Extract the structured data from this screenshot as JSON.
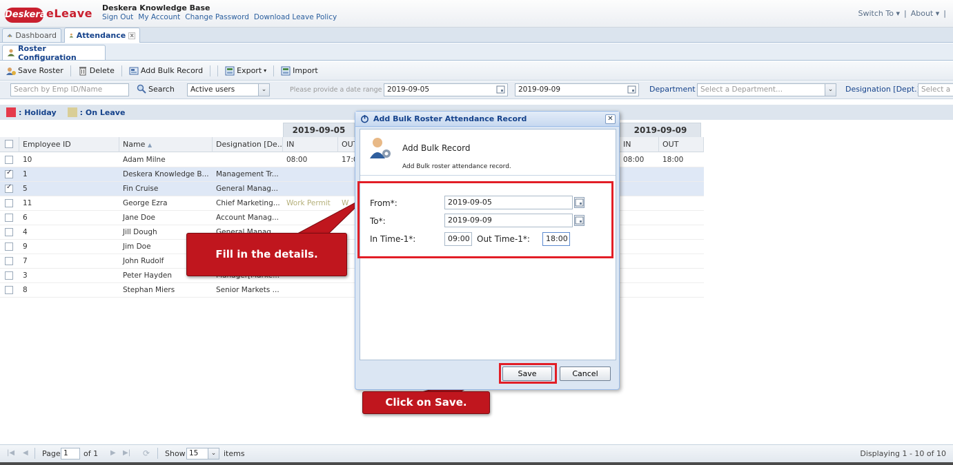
{
  "header": {
    "logo_brand": "Deskera",
    "logo_product": "eLeave",
    "company": "Deskera Knowledge Base",
    "links": [
      "Sign Out",
      "My Account",
      "Change Password",
      "Download Leave Policy"
    ],
    "switch_to": "Switch To",
    "about": "About"
  },
  "tabs": {
    "dashboard": "Dashboard",
    "attendance": "Attendance",
    "roster_config": "Roster Configuration"
  },
  "toolbar": {
    "save_roster": "Save Roster",
    "delete": "Delete",
    "add_bulk": "Add Bulk Record",
    "export": "Export",
    "import": "Import"
  },
  "filters": {
    "search_placeholder": "Search by Emp ID/Name",
    "search_button": "Search",
    "user_filter": "Active users",
    "date_hint": "Please provide a date range",
    "date_from": "2019-09-05",
    "date_to": "2019-09-09",
    "department_label": "Department :",
    "department_placeholder": "Select a Department...",
    "designation_label": "Designation [Dept.] :",
    "designation_placeholder": "Select a"
  },
  "legend": {
    "holiday": ": Holiday",
    "on_leave": ": On Leave",
    "holiday_color": "#e53a4a",
    "leave_color": "#d9ce97"
  },
  "grid": {
    "date_group_1": "2019-09-05",
    "date_group_2": "2019-09-09",
    "headers": {
      "employee_id": "Employee ID",
      "name": "Name",
      "designation": "Designation [De...",
      "in": "IN",
      "out": "OUT"
    },
    "rows": [
      {
        "id": "10",
        "name": "Adam Milne",
        "designation": "",
        "in1": "08:00",
        "out1": "17:0",
        "in2": "08:00",
        "out2": "18:00",
        "selected": false
      },
      {
        "id": "1",
        "name": "Deskera Knowledge B...",
        "designation": "Management Tr...",
        "in1": "",
        "out1": "",
        "in2": "",
        "out2": "",
        "selected": true
      },
      {
        "id": "5",
        "name": "Fin Cruise",
        "designation": "General Manag...",
        "in1": "",
        "out1": "",
        "in2": "",
        "out2": "",
        "selected": true
      },
      {
        "id": "11",
        "name": "George Ezra",
        "designation": "Chief Marketing...",
        "in1": "Work Permit",
        "out1": "W",
        "in2": "",
        "out2": "",
        "selected": false
      },
      {
        "id": "6",
        "name": "Jane Doe",
        "designation": "Account Manag...",
        "in1": "",
        "out1": "",
        "in2": "",
        "out2": "",
        "selected": false
      },
      {
        "id": "4",
        "name": "Jill Dough",
        "designation": "General Manag...",
        "in1": "",
        "out1": "",
        "in2": "",
        "out2": "",
        "selected": false
      },
      {
        "id": "9",
        "name": "Jim Doe",
        "designation": "",
        "in1": "",
        "out1": "",
        "in2": "",
        "out2": "",
        "selected": false
      },
      {
        "id": "7",
        "name": "John Rudolf",
        "designation": "",
        "in1": "",
        "out1": "",
        "in2": "",
        "out2": "",
        "selected": false
      },
      {
        "id": "3",
        "name": "Peter Hayden",
        "designation": "Manager[Marke...",
        "in1": "",
        "out1": "",
        "in2": "",
        "out2": "",
        "selected": false
      },
      {
        "id": "8",
        "name": "Stephan Miers",
        "designation": "Senior Markets ...",
        "in1": "",
        "out1": "",
        "in2": "",
        "out2": "",
        "selected": false
      }
    ]
  },
  "footer": {
    "page_label": "Page",
    "page_value": "1",
    "of_label": "of 1",
    "show_label": "Show",
    "show_value": "15",
    "items_label": "items",
    "displaying": "Displaying 1 - 10 of 10"
  },
  "dialog": {
    "title": "Add Bulk Roster Attendance Record",
    "heading": "Add Bulk Record",
    "subheading": "Add Bulk roster attendance record.",
    "from_label": "From*:",
    "from_value": "2019-09-05",
    "to_label": "To*:",
    "to_value": "2019-09-09",
    "in_label": "In Time-1*:",
    "in_value": "09:00",
    "out_label": "Out Time-1*:",
    "out_value": "18:00",
    "save": "Save",
    "cancel": "Cancel"
  },
  "callouts": {
    "fill": "Fill in the details.",
    "save": "Click on Save."
  }
}
